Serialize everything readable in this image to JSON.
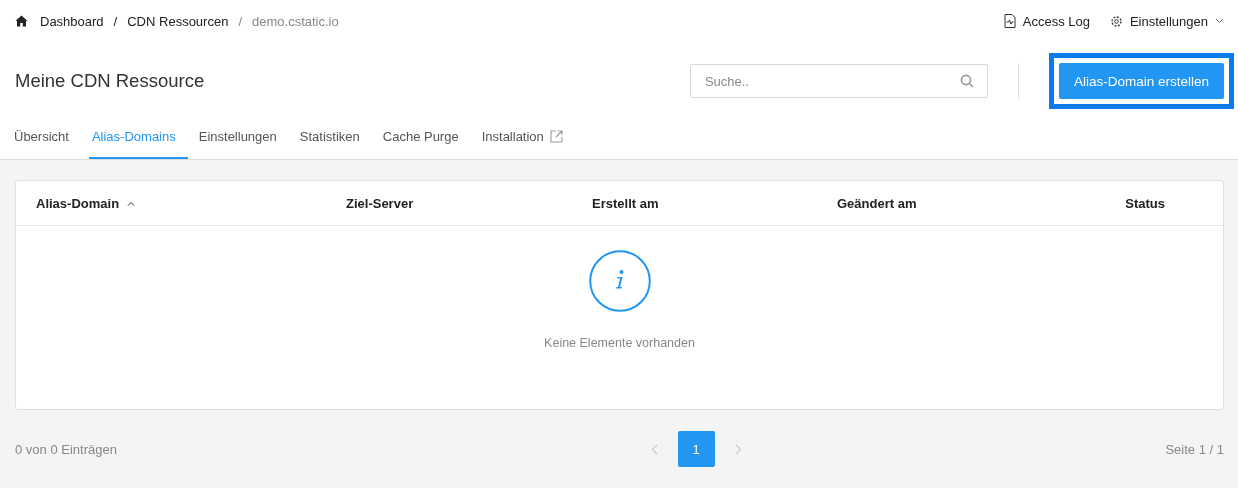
{
  "breadcrumbs": [
    {
      "label": "Dashboard",
      "current": false
    },
    {
      "label": "CDN Ressourcen",
      "current": false
    },
    {
      "label": "demo.cstatic.io",
      "current": true
    }
  ],
  "breadcrumb_separators": [
    "/",
    "/"
  ],
  "top_links": [
    {
      "label": "Access Log",
      "kind": "log",
      "dropdown": false
    },
    {
      "label": "Einstellungen",
      "kind": "settings",
      "dropdown": true
    }
  ],
  "page_title": "Meine CDN Ressource",
  "search": {
    "placeholder": "Suche.."
  },
  "primary_button": {
    "label": "Alias-Domain erstellen",
    "highlighted": true
  },
  "tabs": [
    {
      "label": "Übersicht",
      "selected": false,
      "external": false
    },
    {
      "label": "Alias-Domains",
      "selected": true,
      "external": false
    },
    {
      "label": "Einstellungen",
      "selected": false,
      "external": false
    },
    {
      "label": "Statistiken",
      "selected": false,
      "external": false
    },
    {
      "label": "Cache Purge",
      "selected": false,
      "external": false
    },
    {
      "label": "Installation",
      "selected": false,
      "external": true
    }
  ],
  "table": {
    "columns": [
      {
        "label": "Alias-Domain",
        "sorted": true
      },
      {
        "label": "Ziel-Server",
        "sorted": false
      },
      {
        "label": "Erstellt am",
        "sorted": false
      },
      {
        "label": "Geändert am",
        "sorted": false
      },
      {
        "label": "Status",
        "sorted": false
      }
    ],
    "empty_message": "Keine Elemente vorhanden"
  },
  "footer": {
    "count": "0 von 0 Einträgen",
    "page_info": "Seite 1 / 1",
    "pagination": {
      "prev_disabled": true,
      "next_disabled": true,
      "pages": [
        {
          "label": "1",
          "selected": true
        }
      ]
    }
  }
}
